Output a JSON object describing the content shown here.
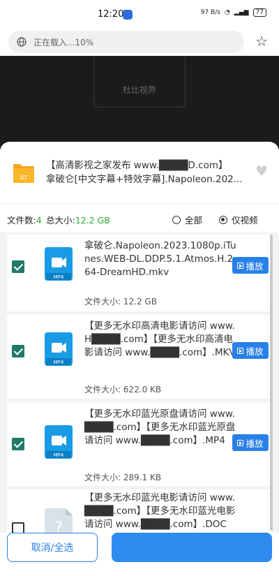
{
  "status_bar": {
    "time": "12:20",
    "net_speed": "97 B/s",
    "battery": "77"
  },
  "address_bar": {
    "loading_text": "正在载入...10%"
  },
  "background_page": {
    "card_label": "杜比视界"
  },
  "torrent": {
    "name_line1": "【高清影视之家发布 www.████D.com】",
    "name_line2": "拿破仑[中文字幕+特效字幕].Napoleon.202..."
  },
  "stats": {
    "file_count_label": "文件数:",
    "file_count": "4",
    "total_size_label": "总大小:",
    "total_size": "12.2 GB",
    "filter_all": "全部",
    "filter_video_only": "仅视频",
    "selected_filter": "仅视频"
  },
  "files": [
    {
      "name": "拿破仑.Napoleon.2023.1080p.iTunes.WEB-DL.DDP.5.1.Atmos.H.264-DreamHD.mkv",
      "size": "文件大小: 12.2 GB",
      "checked": true,
      "icon": "video-file-icon",
      "icon_label": "MP4",
      "play_label": "播放"
    },
    {
      "name": "【更多无水印高清电影请访问 www.H████.com】【更多无水印高清电影请访问 www.████.com】.MKV",
      "size": "文件大小: 622.0 KB",
      "checked": true,
      "icon": "video-file-icon",
      "icon_label": "MP4",
      "play_label": "播放"
    },
    {
      "name": "【更多无水印蓝光原盘请访问 www.████.com】【更多无水印蓝光原盘请访问 www.████.com】.MP4",
      "size": "文件大小: 289.1 KB",
      "checked": true,
      "icon": "video-file-icon",
      "icon_label": "MP4",
      "play_label": "播放"
    },
    {
      "name": "【更多无水印蓝光电影请访问 www.████.com】【更多无水印蓝光电影请访问 www.████.com】.DOC",
      "size": "",
      "checked": false,
      "icon": "unknown-file-icon",
      "icon_label": "?",
      "play_label": ""
    }
  ],
  "footer": {
    "cancel_label": "取消/全选",
    "confirm_label": ""
  },
  "colors": {
    "accent": "#2980e8",
    "check": "#1f7a6a",
    "size_green": "#2faa3a"
  }
}
